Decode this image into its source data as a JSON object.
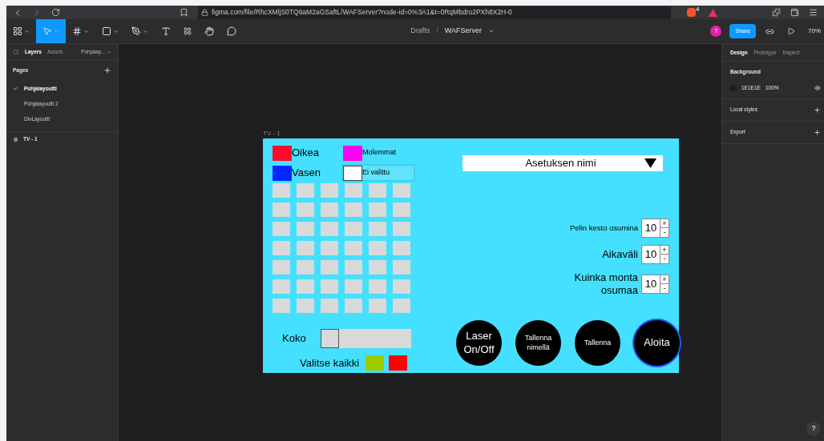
{
  "browser": {
    "url": "figma.com/file/RhcXMljS0TQ6aM2aGSaftL/WAFServer?node-id=0%3A1&t=0RqMbdro2PXh8X2H-0",
    "shield_count": "4"
  },
  "toolbar": {
    "breadcrumb": "Drafts",
    "separator": "/",
    "file_name": "WAFServer",
    "avatar": "T",
    "share": "Share",
    "zoom": "70%"
  },
  "left_panel": {
    "tabs": [
      {
        "label": "Layers",
        "selected": true
      },
      {
        "label": "Assets",
        "selected": false
      }
    ],
    "page_menu": "Pohjalay...",
    "pages_title": "Pages",
    "pages": [
      {
        "label": "Pohjalayoutti",
        "selected": true
      },
      {
        "label": "Pohjalayoutti 2",
        "selected": false
      },
      {
        "label": "DivLayoutti",
        "selected": false
      }
    ],
    "layers": [
      {
        "label": "TV - 1"
      }
    ]
  },
  "right_panel": {
    "tabs": [
      {
        "label": "Design",
        "selected": true
      },
      {
        "label": "Prototype",
        "selected": false
      },
      {
        "label": "Inspect",
        "selected": false
      }
    ],
    "background_title": "Background",
    "background_hex": "1E1E1E",
    "background_opacity": "100%",
    "local_styles": "Local styles",
    "export": "Export"
  },
  "frame": {
    "label": "TV - 1",
    "colors": [
      {
        "label": "Oikea",
        "color": "#ff0a2a",
        "selected": false
      },
      {
        "label": "Molemmat",
        "color": "#ff00f0",
        "selected": false
      },
      {
        "label": "Vasen",
        "color": "#0028ff",
        "selected": false
      },
      {
        "label": "Ei valittu",
        "color": "#ffffff",
        "selected": true
      }
    ],
    "size_label": "Koko",
    "size": {
      "level": 0
    },
    "select_all_label": "Valitse kaikki",
    "select_all_colors": [
      {
        "color": "#9ccc00"
      },
      {
        "color": "#ff0000"
      }
    ],
    "preset": "Asetuksen nimi",
    "settings": [
      {
        "label": "Pelin kesto osumina",
        "value": "10",
        "kind": "compact"
      },
      {
        "label": "Aikaväli",
        "value": "10",
        "kind": "normal"
      },
      {
        "label": "Kuinka monta osumaa",
        "value": "10",
        "kind": "normal"
      }
    ],
    "spin_plus": "+",
    "spin_minus": "-",
    "buttons": [
      {
        "label": "Laser On/Off",
        "kind": "normal",
        "highlighted": false
      },
      {
        "label": "Tallenna nimellä",
        "kind": "compact",
        "highlighted": false
      },
      {
        "label": "Tallenna",
        "kind": "compact",
        "highlighted": false
      },
      {
        "label": "Aloita",
        "kind": "normal",
        "highlighted": true
      }
    ]
  },
  "help": "?"
}
